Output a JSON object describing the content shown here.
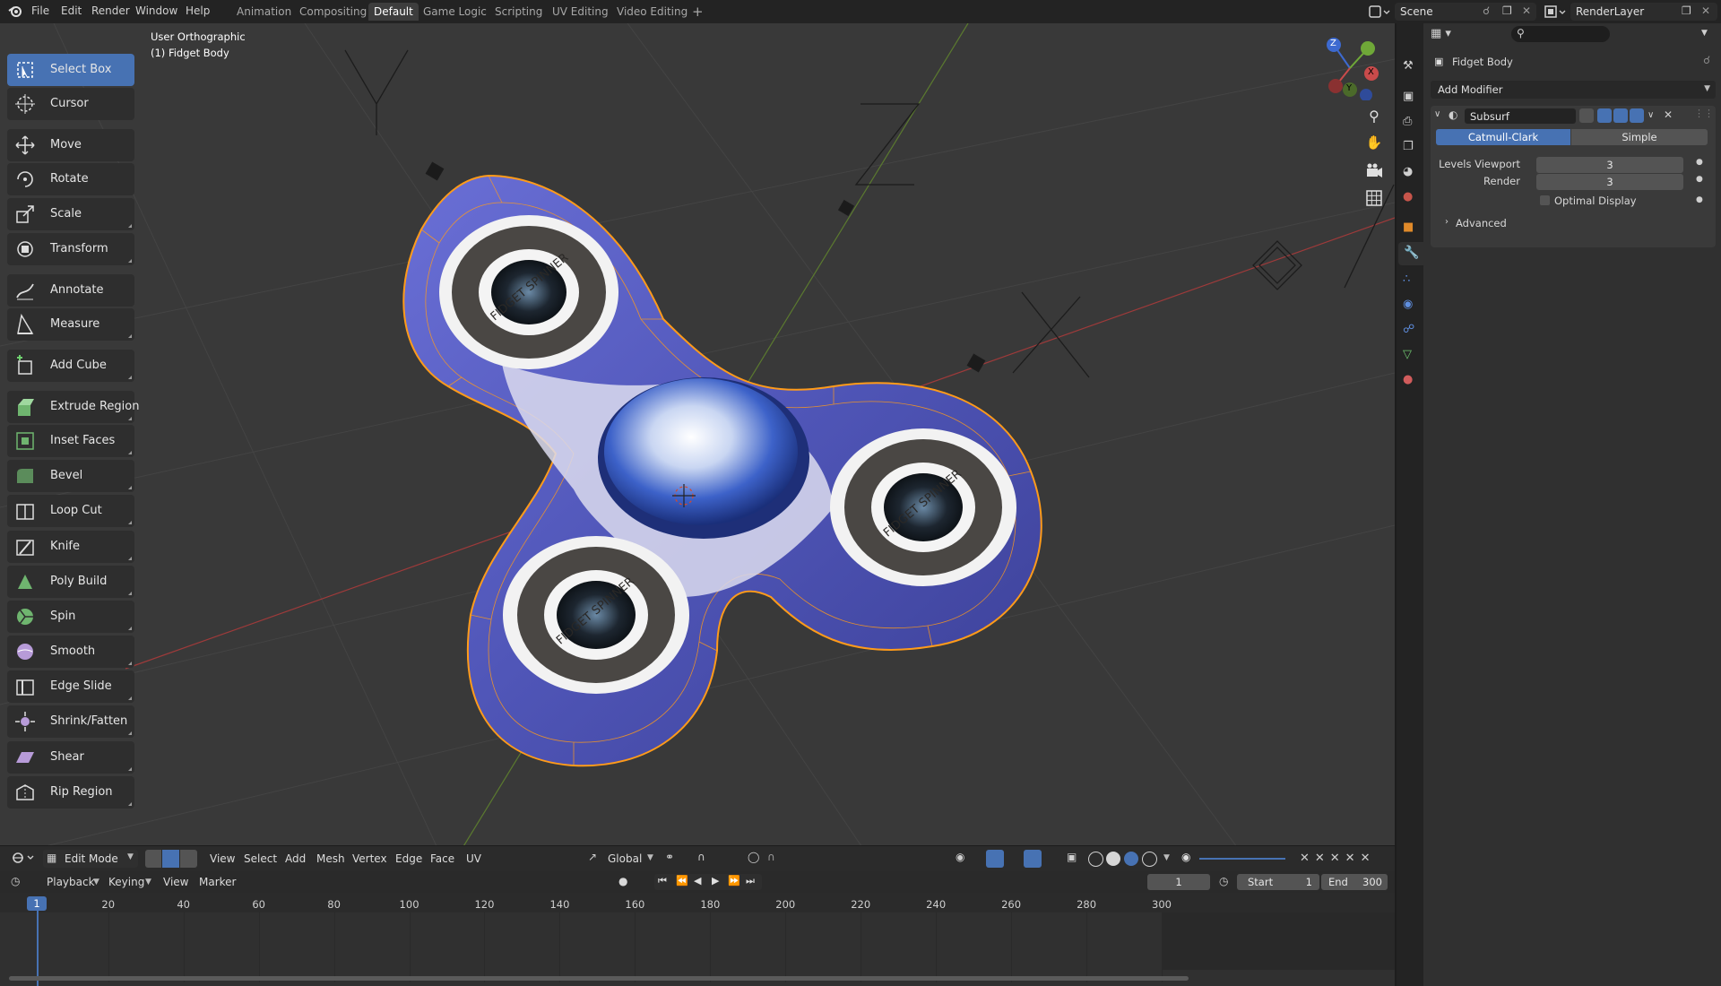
{
  "topbar": {
    "menus": [
      "File",
      "Edit",
      "Render",
      "Window",
      "Help"
    ],
    "workspaces": [
      "Animation",
      "Compositing",
      "Default",
      "Game Logic",
      "Scripting",
      "UV Editing",
      "Video Editing"
    ],
    "active_workspace": "Default",
    "add_workspace": "+",
    "scene": "Scene",
    "render_layer": "RenderLayer"
  },
  "viewport": {
    "view_name": "User Orthographic",
    "object_info": "(1) Fidget Body",
    "tools": [
      "Select Box",
      "Cursor",
      "Move",
      "Rotate",
      "Scale",
      "Transform",
      "Annotate",
      "Measure",
      "Add Cube",
      "Extrude Region",
      "Inset Faces",
      "Bevel",
      "Loop Cut",
      "Knife",
      "Poly Build",
      "Spin",
      "Smooth",
      "Edge Slide",
      "Shrink/Fatten",
      "Shear",
      "Rip Region"
    ],
    "active_tool": "Select Box",
    "gizmo_axes": [
      "Z",
      "Y",
      "X"
    ],
    "mesh_text": "FIDGET SPINNER"
  },
  "header": {
    "mode": "Edit Mode",
    "menus": [
      "View",
      "Select",
      "Add",
      "Mesh",
      "Vertex",
      "Edge",
      "Face",
      "UV"
    ],
    "orientation": "Global"
  },
  "timeline": {
    "menus": [
      "Playback",
      "Keying",
      "View",
      "Marker"
    ],
    "current_frame": "1",
    "start_label": "Start",
    "start": "1",
    "end_label": "End",
    "end": "300",
    "ticks": [
      "20",
      "40",
      "60",
      "80",
      "100",
      "120",
      "140",
      "160",
      "180",
      "200",
      "220",
      "240",
      "260",
      "280",
      "300"
    ],
    "playhead": "1"
  },
  "properties": {
    "object_name": "Fidget Body",
    "add_modifier": "Add Modifier",
    "modifier_name": "Subsurf",
    "subdivision_types": [
      "Catmull-Clark",
      "Simple"
    ],
    "active_type": "Catmull-Clark",
    "levels_viewport_label": "Levels Viewport",
    "levels_viewport": "3",
    "render_label": "Render",
    "render": "3",
    "optimal_display_label": "Optimal Display",
    "advanced_label": "Advanced"
  },
  "colors": {
    "accent": "#4772b3",
    "selection_orange": "#ff9b1a",
    "viewport_bg": "#393939",
    "panel_bg": "#303030"
  }
}
